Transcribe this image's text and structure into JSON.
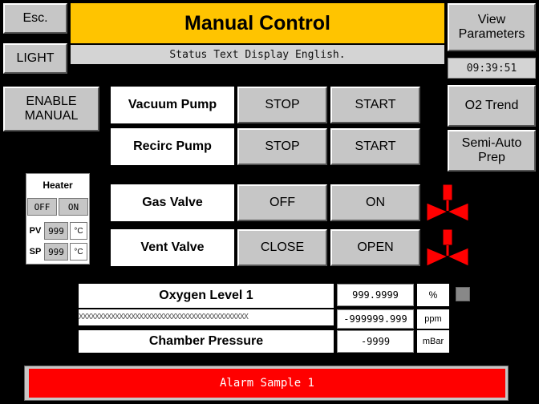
{
  "header": {
    "esc_label": "Esc.",
    "light_label": "LIGHT",
    "title": "Manual Control",
    "status_text": "Status Text Display English.",
    "view_params_label": "View Parameters",
    "clock": "09:39:51",
    "title_color": "#ffc400"
  },
  "left": {
    "enable_manual_label": "ENABLE MANUAL"
  },
  "right": {
    "o2_trend_label": "O2 Trend",
    "semi_auto_label": "Semi-Auto Prep"
  },
  "controls": {
    "vacuum_pump": {
      "label": "Vacuum Pump",
      "stop": "STOP",
      "start": "START"
    },
    "recirc_pump": {
      "label": "Recirc Pump",
      "stop": "STOP",
      "start": "START"
    },
    "gas_valve": {
      "label": "Gas Valve",
      "off": "OFF",
      "on": "ON",
      "indicator": "valve-icon"
    },
    "vent_valve": {
      "label": "Vent Valve",
      "close": "CLOSE",
      "open": "OPEN",
      "indicator": "valve-icon"
    }
  },
  "heater": {
    "title": "Heater",
    "off": "OFF",
    "on": "ON",
    "pv_label": "PV",
    "pv_value": "999",
    "sp_label": "SP",
    "sp_value": "999",
    "unit": "°C"
  },
  "readings": {
    "oxygen_label": "Oxygen Level 1",
    "oxygen_pct": "999.9999",
    "pct_unit": "%",
    "oxygen_ppm": "-999999.999",
    "ppm_unit": "ppm",
    "hatch_text": "XXXXXXXXXXXXXXXXXXXXXXXXXXXXXXXXXXXXXXXXXX",
    "pressure_label": "Chamber Pressure",
    "pressure_value": "-9999",
    "pressure_unit": "mBar"
  },
  "alarm": {
    "text": "Alarm Sample 1",
    "color": "#ff0000"
  },
  "colors": {
    "valve": "#ff0000",
    "background": "#000000",
    "button": "#c6c6c6"
  }
}
